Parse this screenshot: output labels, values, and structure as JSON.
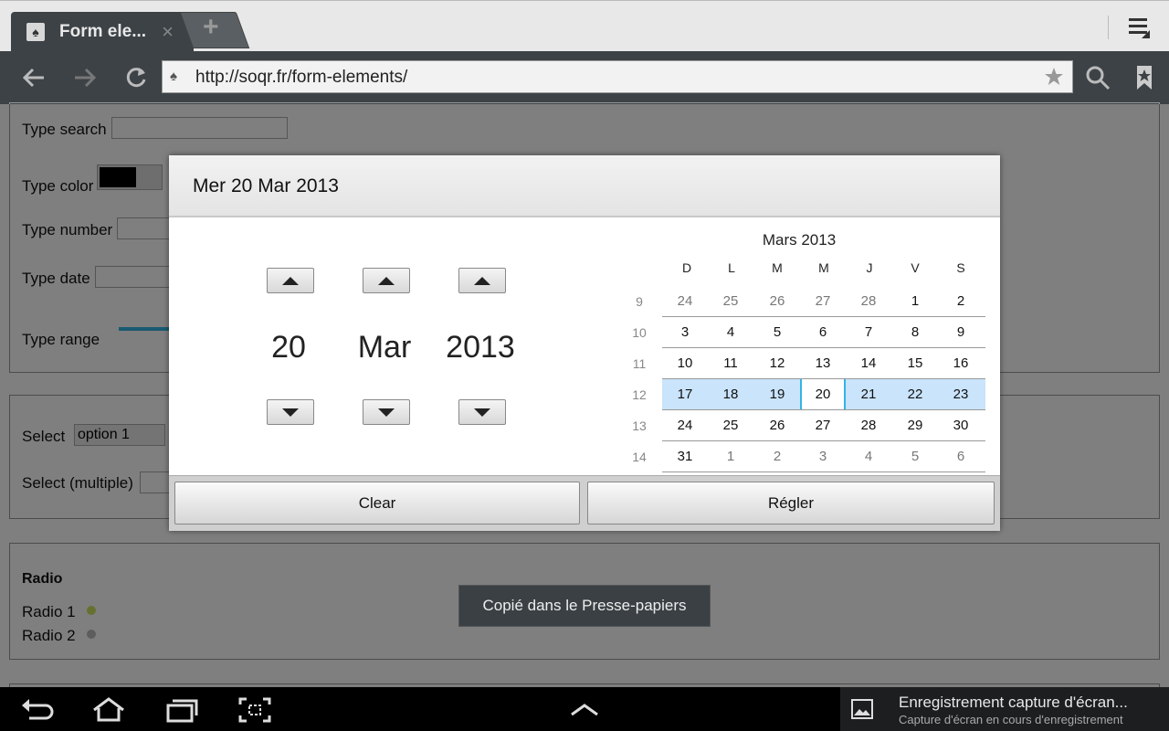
{
  "tab": {
    "title": "Form ele...",
    "close": "×",
    "new_tab": "+"
  },
  "toolbar": {
    "url": "http://soqr.fr/form-elements/"
  },
  "form": {
    "search_label": "Type search",
    "color_label": "Type color",
    "number_label": "Type number",
    "date_label": "Type date",
    "range_label": "Type range",
    "select_label": "Select",
    "select_value": "option 1",
    "select_multiple_label": "Select (multiple)",
    "radio_heading": "Radio",
    "radio1_label": "Radio 1",
    "radio2_label": "Radio 2"
  },
  "dialog": {
    "title": "Mer 20 Mar 2013",
    "day": "20",
    "month": "Mar",
    "year": "2013",
    "clear_label": "Clear",
    "set_label": "Régler"
  },
  "calendar": {
    "month_title": "Mars 2013",
    "weekdays": [
      "D",
      "L",
      "M",
      "M",
      "J",
      "V",
      "S"
    ],
    "weeks": [
      {
        "num": "9",
        "days": [
          "24",
          "25",
          "26",
          "27",
          "28",
          "1",
          "2"
        ]
      },
      {
        "num": "10",
        "days": [
          "3",
          "4",
          "5",
          "6",
          "7",
          "8",
          "9"
        ]
      },
      {
        "num": "11",
        "days": [
          "10",
          "11",
          "12",
          "13",
          "14",
          "15",
          "16"
        ]
      },
      {
        "num": "12",
        "days": [
          "17",
          "18",
          "19",
          "20",
          "21",
          "22",
          "23"
        ]
      },
      {
        "num": "13",
        "days": [
          "24",
          "25",
          "26",
          "27",
          "28",
          "29",
          "30"
        ]
      },
      {
        "num": "14",
        "days": [
          "31",
          "1",
          "2",
          "3",
          "4",
          "5",
          "6"
        ]
      }
    ]
  },
  "toast": {
    "text": "Copié dans le Presse-papiers"
  },
  "notification": {
    "title": "Enregistrement capture d'écran...",
    "subtitle": "Capture d'écran en cours d'enregistrement"
  },
  "colors": {
    "accent": "#33b5e5",
    "selected_week": "#c9e4fb",
    "toolbar": "#3c4246"
  },
  "icons": [
    "back-icon",
    "forward-icon",
    "reload-icon",
    "site-icon",
    "star-icon",
    "search-icon",
    "bookmarks-icon",
    "menu-icon",
    "home-icon",
    "recent-apps-icon",
    "screenshot-icon",
    "chevron-up-icon",
    "image-icon"
  ]
}
